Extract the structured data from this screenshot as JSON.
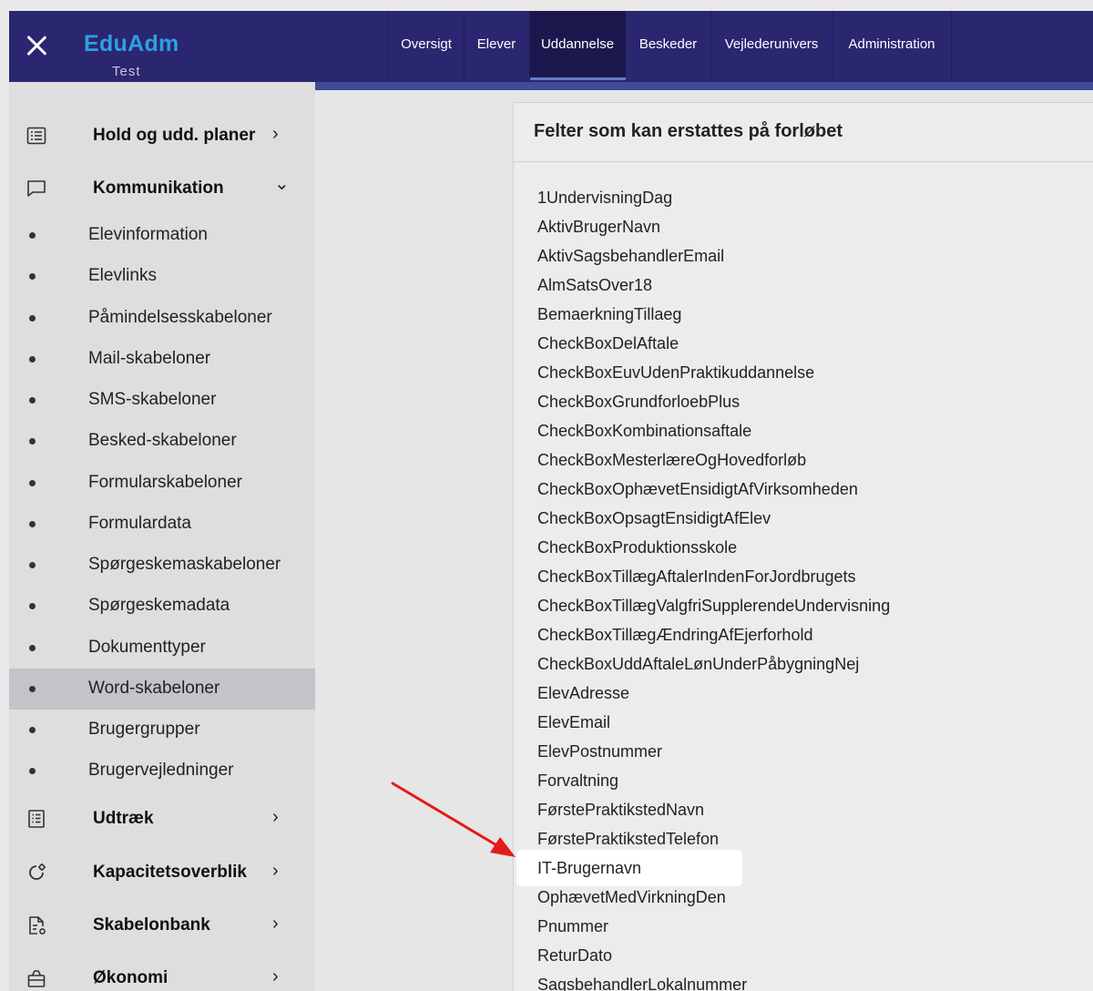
{
  "app": {
    "title": "EduAdm",
    "subtitle": "Test"
  },
  "topnav": {
    "tabs": [
      "Oversigt",
      "Elever",
      "Uddannelse",
      "Beskeder",
      "Vejlederunivers",
      "Administration"
    ],
    "active": "Uddannelse"
  },
  "sidebar": {
    "hold": "Hold og udd. planer",
    "kommunikation": "Kommunikation",
    "sub_items": [
      "Elevinformation",
      "Elevlinks",
      "Påmindelsesskabeloner",
      "Mail-skabeloner",
      "SMS-skabeloner",
      "Besked-skabeloner",
      "Formularskabeloner",
      "Formulardata",
      "Spørgeskemaskabeloner",
      "Spørgeskemadata",
      "Dokumenttyper",
      "Word-skabeloner",
      "Brugergrupper",
      "Brugervejledninger"
    ],
    "active_sub": "Word-skabeloner",
    "udtraek": "Udtræk",
    "kapacitet": "Kapacitetsoverblik",
    "skabelonbank": "Skabelonbank",
    "oekonomi": "Økonomi"
  },
  "card": {
    "title": "Felter som kan erstattes på forløbet",
    "fields": [
      "1UndervisningDag",
      "AktivBrugerNavn",
      "AktivSagsbehandlerEmail",
      "AlmSatsOver18",
      "BemaerkningTillaeg",
      "CheckBoxDelAftale",
      "CheckBoxEuvUdenPraktikuddannelse",
      "CheckBoxGrundforloebPlus",
      "CheckBoxKombinationsaftale",
      "CheckBoxMesterlæreOgHovedforløb",
      "CheckBoxOphævetEnsidigtAfVirksomheden",
      "CheckBoxOpsagtEnsidigtAfElev",
      "CheckBoxProduktionsskole",
      "CheckBoxTillægAftalerIndenForJordbrugets",
      "CheckBoxTillægValgfriSupplerendeUndervisning",
      "CheckBoxTillægÆndringAfEjerforhold",
      "CheckBoxUddAftaleLønUnderPåbygningNej",
      "ElevAdresse",
      "ElevEmail",
      "ElevPostnummer",
      "Forvaltning",
      "FørstePraktikstedNavn",
      "FørstePraktikstedTelefon",
      "IT-Brugernavn",
      "OphævetMedVirkningDen",
      "Pnummer",
      "ReturDato",
      "SagsbehandlerLokalnummer"
    ],
    "highlighted_field": "IT-Brugernavn"
  },
  "colors": {
    "header_bg": "#2b2670",
    "brand": "#2e9fe0",
    "arrow": "#e31b1b"
  },
  "icons": {
    "close": "close-icon",
    "hold": "list-icon",
    "kommunikation": "chat-icon",
    "udtraek": "report-icon",
    "kapacitet": "gear-icon",
    "skabelonbank": "file-settings-icon",
    "oekonomi": "bag-icon"
  }
}
